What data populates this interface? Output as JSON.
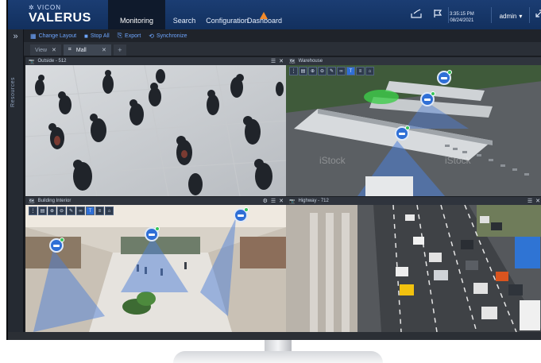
{
  "app": {
    "brand": "VICON",
    "product": "VALERUS"
  },
  "nav": {
    "tabs": [
      {
        "label": "Monitoring",
        "active": true
      },
      {
        "label": "Search",
        "active": false
      },
      {
        "label": "Configuration",
        "active": false
      },
      {
        "label": "Dashboard",
        "active": false
      }
    ]
  },
  "status": {
    "time": "3:35:15 PM",
    "date": "08/24/2021",
    "user": "admin"
  },
  "rail": {
    "label": "Resources"
  },
  "toolbar": {
    "change_layout": "Change Layout",
    "stop_all": "Stop All",
    "export": "Export",
    "synchronize": "Synchronize"
  },
  "view_tabs": [
    {
      "label": "View"
    },
    {
      "label": "Mall"
    }
  ],
  "panes": {
    "outside": {
      "title": "Outside - 512"
    },
    "warehouse": {
      "title": "Warehouse"
    },
    "building": {
      "title": "Building Interior"
    },
    "highway": {
      "title": "Highway - 712"
    }
  },
  "colors": {
    "accent": "#2f6fd6",
    "topbar": "#1b3d73",
    "online_dot": "#38c45a",
    "warning": "#f18a2b"
  },
  "watermark": "iStock"
}
